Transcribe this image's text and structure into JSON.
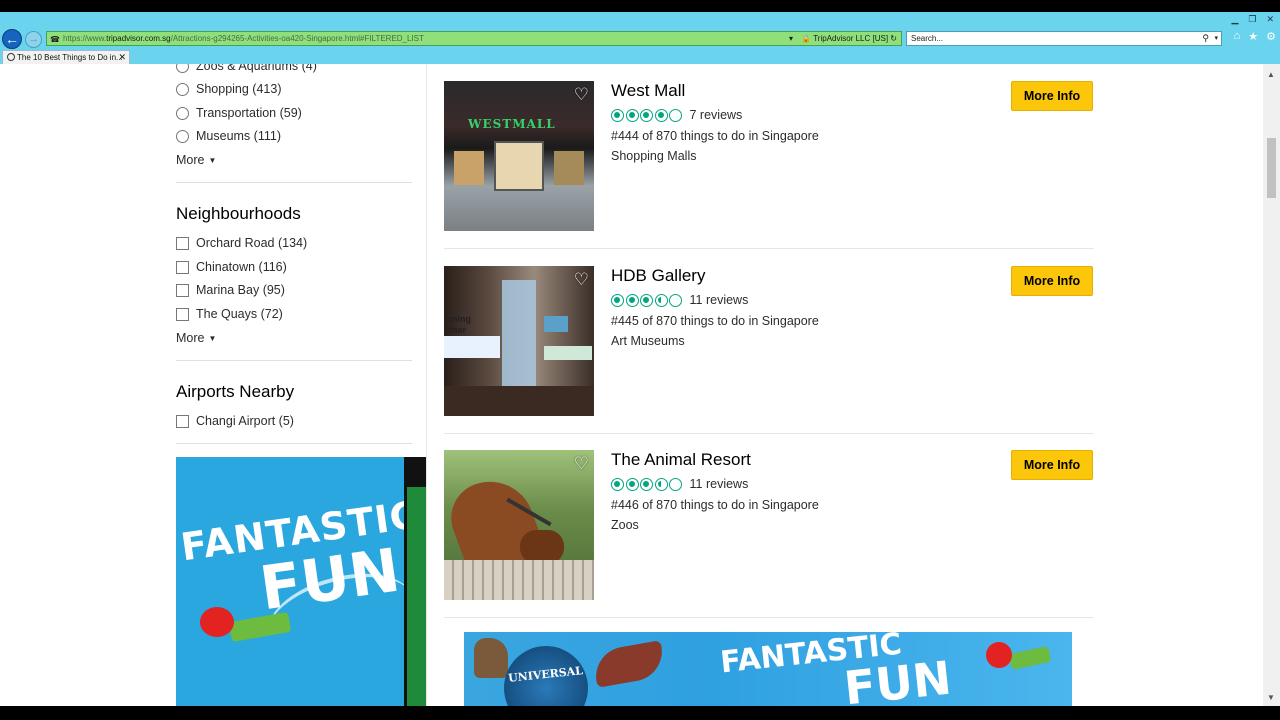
{
  "browser": {
    "url_prefix": "https://www.",
    "url_domain": "tripadvisor.com.sg",
    "url_path": "/Attractions-g294265-Activities-oa420-Singapore.html#FILTERED_LIST",
    "cert": "TripAdvisor LLC [US]",
    "search_placeholder": "Search...",
    "tab_title": "The 10 Best Things to Do in..."
  },
  "sidebar": {
    "types": [
      {
        "label": "Zoos & Aquariums (4)"
      },
      {
        "label": "Shopping (413)"
      },
      {
        "label": "Transportation (59)"
      },
      {
        "label": "Museums (111)"
      }
    ],
    "types_more": "More",
    "neighbourhoods_title": "Neighbourhoods",
    "neighbourhoods": [
      {
        "label": "Orchard Road (134)"
      },
      {
        "label": "Chinatown (116)"
      },
      {
        "label": "Marina Bay (95)"
      },
      {
        "label": "The Quays (72)"
      }
    ],
    "neighbourhoods_more": "More",
    "airports_title": "Airports Nearby",
    "airports": [
      {
        "label": "Changi Airport (5)"
      }
    ],
    "ad": {
      "line1": "FANTASTIC",
      "line2": "FUN"
    }
  },
  "listings": [
    {
      "title": "West Mall",
      "rating": 4,
      "reviews": "7 reviews",
      "rank": "#444 of 870 things to do in Singapore",
      "category": "Shopping Malls",
      "button": "More Info",
      "image_text": "WESTMALL"
    },
    {
      "title": "HDB Gallery",
      "rating": 3.5,
      "reviews": "11 reviews",
      "rank": "#445 of 870 things to do in Singapore",
      "category": "Art Museums",
      "button": "More Info",
      "image_text": "oming\nether"
    },
    {
      "title": "The Animal Resort",
      "rating": 3.5,
      "reviews": "11 reviews",
      "rank": "#446 of 870 things to do in Singapore",
      "category": "Zoos",
      "button": "More Info"
    }
  ],
  "banner": {
    "brand": "UNIVERSAL",
    "line1": "FANTASTIC",
    "line2": "FUN"
  },
  "colors": {
    "accent_button": "#fcc70a",
    "rating": "#00a680",
    "chrome": "#6ad3ee"
  }
}
